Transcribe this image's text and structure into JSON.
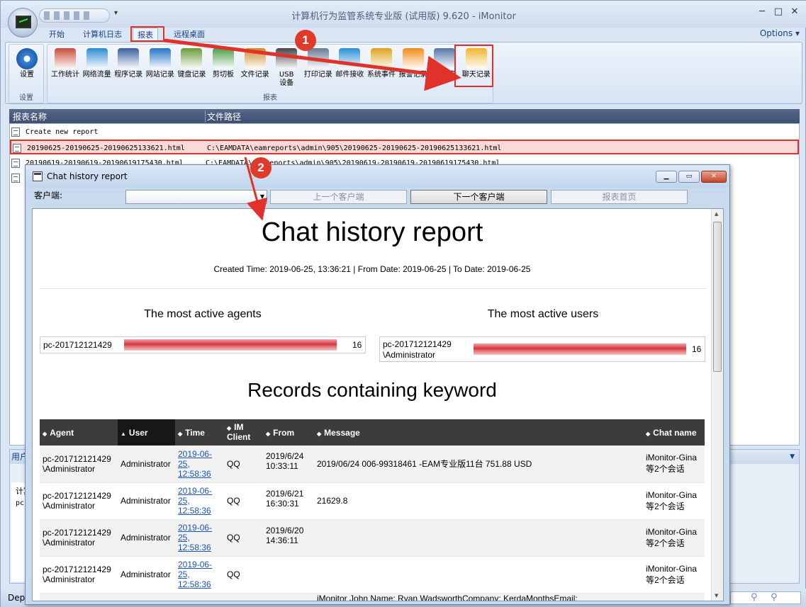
{
  "window": {
    "title": "计算机行为监管系统专业版 (试用版) 9.620 - iMonitor",
    "options_label": "Options"
  },
  "ribbon_tabs": [
    "开始",
    "计算机日志",
    "报表",
    "远程桌面"
  ],
  "ribbon": {
    "settings_group_label": "设置",
    "settings_button": "设置",
    "reports_group_label": "报表",
    "buttons": [
      {
        "label": "工作统计",
        "icon": "work-stats-icon"
      },
      {
        "label": "网络流量",
        "icon": "network-traffic-icon"
      },
      {
        "label": "程序记录",
        "icon": "program-log-icon"
      },
      {
        "label": "网站记录",
        "icon": "website-log-icon"
      },
      {
        "label": "键盘记录",
        "icon": "keyboard-log-icon"
      },
      {
        "label": "剪切板",
        "icon": "clipboard-icon"
      },
      {
        "label": "文件记录",
        "icon": "file-log-icon"
      },
      {
        "label": "USB\n设备",
        "icon": "usb-device-icon"
      },
      {
        "label": "打印记录",
        "icon": "print-log-icon"
      },
      {
        "label": "邮件接收",
        "icon": "mail-receive-icon"
      },
      {
        "label": "系统事件",
        "icon": "system-event-icon"
      },
      {
        "label": "报警记录",
        "icon": "alarm-log-icon"
      },
      {
        "label": "关键字",
        "icon": "keyword-icon"
      },
      {
        "label": "聊天记录",
        "icon": "chat-log-icon"
      }
    ]
  },
  "report_list": {
    "col_name": "报表名称",
    "col_path": "文件路径",
    "rows": [
      {
        "name": "Create new report",
        "path": ""
      },
      {
        "name": "20190625-20190625-20190625133621.html",
        "path": "C:\\EAMDATA\\eamreports\\admin\\905\\20190625-20190625-20190625133621.html"
      },
      {
        "name": "20190619-20190619-20190619175430.html",
        "path": "C:\\EAMDATA\\eamreports\\admin\\905\\20190619-20190619-20190619175430.html"
      },
      {
        "name": "",
        "path": ""
      }
    ]
  },
  "bottom_panel": {
    "header": "用户",
    "line1": "计算",
    "line2": "pc"
  },
  "statusbar": {
    "left": "Depa"
  },
  "annotations": [
    "1",
    "2"
  ],
  "dialog": {
    "title": "Chat history report",
    "client_label": "客户端:",
    "client_value": "",
    "prev_button": "上一个客户端",
    "next_button": "下一个客户端",
    "home_button": "报表首页"
  },
  "report": {
    "title": "Chat history report",
    "meta": "Created Time: 2019-06-25, 13:36:21 | From Date: 2019-06-25 | To Date: 2019-06-25",
    "agents_title": "The most active agents",
    "users_title": "The most active users",
    "top_agent": {
      "name": "pc-201712121429",
      "count": "16"
    },
    "top_user": {
      "name_line1": "pc-201712121429",
      "name_line2": "\\Administrator",
      "count": "16"
    },
    "keyword_title": "Records containing keyword",
    "columns": [
      "Agent",
      "User",
      "Time",
      "IM\nClient",
      "From",
      "Message",
      "Chat name"
    ],
    "sorted_column": "User",
    "records": [
      {
        "agent1": "pc-201712121429",
        "agent2": "\\Administrator",
        "user": "Administrator",
        "time1": "2019-06-",
        "time2": "25,",
        "time3": "12:58:36",
        "client": "QQ",
        "from1": "2019/6/24",
        "from2": "10:33:11",
        "message": "2019/06/24 006-99318461 -EAM专业版11台  751.88 USD",
        "chat1": "iMonitor-Gina",
        "chat2": "等2个会话"
      },
      {
        "agent1": "pc-201712121429",
        "agent2": "\\Administrator",
        "user": "Administrator",
        "time1": "2019-06-",
        "time2": "25,",
        "time3": "12:58:36",
        "client": "QQ",
        "from1": "2019/6/21",
        "from2": "16:30:31",
        "message": "21629.8",
        "chat1": "iMonitor-Gina",
        "chat2": "等2个会话"
      },
      {
        "agent1": "pc-201712121429",
        "agent2": "\\Administrator",
        "user": "Administrator",
        "time1": "2019-06-",
        "time2": "25,",
        "time3": "12:58:36",
        "client": "QQ",
        "from1": "2019/6/20",
        "from2": "14:36:11",
        "message": "",
        "chat1": "iMonitor-Gina",
        "chat2": "等2个会话"
      },
      {
        "agent1": "pc-201712121429",
        "agent2": "\\Administrator",
        "user": "Administrator",
        "time1": "2019-06-",
        "time2": "25,",
        "time3": "12:58:36",
        "client": "QQ",
        "from1": "",
        "from2": "",
        "message": "",
        "chat1": "iMonitor-Gina",
        "chat2": "等2个会话"
      }
    ],
    "overflow_message": "iMonitor John Name: Ryan WadsworthCompany: KerdaMonthsEmail:"
  },
  "colors": {
    "accent_red": "#e0312a",
    "header_dark": "#3c3c3c",
    "bar_red": "#d6333d",
    "link": "#1a55b5"
  }
}
